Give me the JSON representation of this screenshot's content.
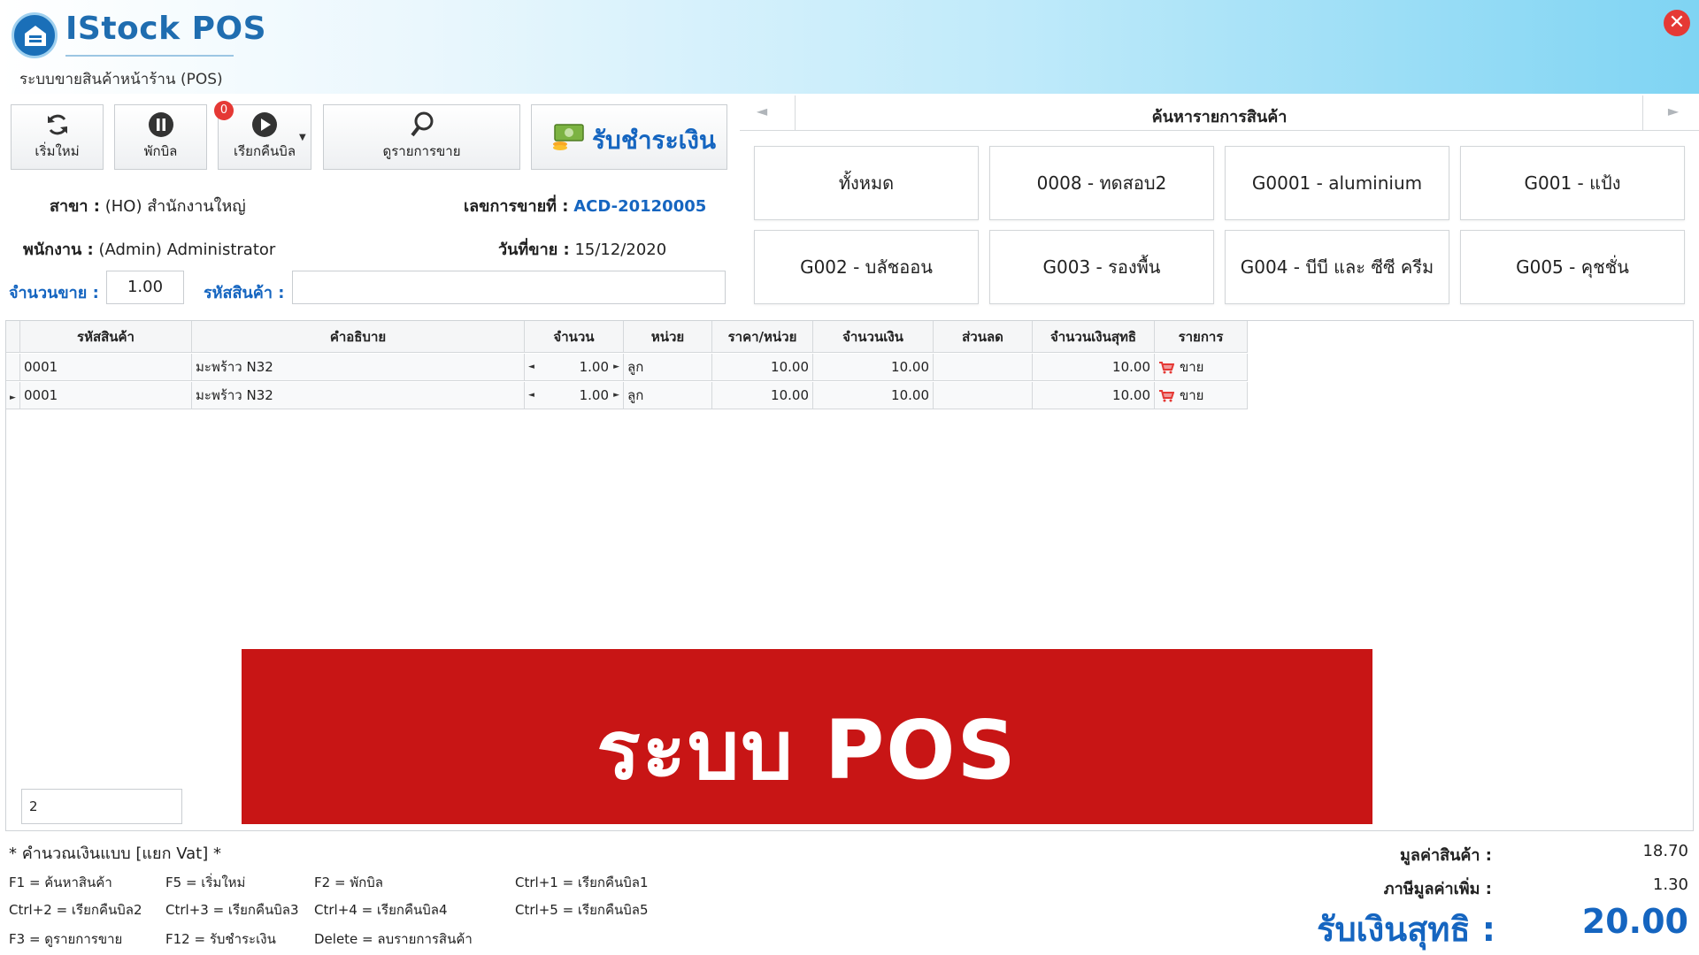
{
  "header": {
    "app_title": "IStock POS",
    "subtitle": "ระบบขายสินค้าหน้าร้าน (POS)",
    "close_symbol": "✕"
  },
  "toolbar": {
    "new_label": "เริ่มใหม่",
    "hold_label": "พักบิล",
    "recall_label": "เรียกคืนบิล",
    "recall_badge": "0",
    "sales_list_label": "ดูรายการขาย",
    "pay_label": "รับชำระเงิน"
  },
  "info": {
    "branch_label": "สาขา :",
    "branch_value": "(HO) สำนักงานใหญ่",
    "invoice_label": "เลขการขายที่ :",
    "invoice_value": "ACD-20120005",
    "staff_label": "พนักงาน :",
    "staff_value": "(Admin) Administrator",
    "date_label": "วันที่ขาย :",
    "date_value": "15/12/2020",
    "qty_label": "จำนวนขาย :",
    "qty_value": "1.00",
    "code_label": "รหัสสินค้า :",
    "code_value": ""
  },
  "product_search": {
    "title": "ค้นหารายการสินค้า",
    "categories": [
      "ทั้งหมด",
      "0008 - ทดสอบ2",
      "G0001 - aluminium",
      "G001 - แป้ง",
      "G002 - บลัชออน",
      "G003 - รองพื้น",
      "G004 - บีบี และ ซีซี ครีม",
      "G005 - คุชชั่น"
    ]
  },
  "grid": {
    "columns": [
      "รหัสสินค้า",
      "คำอธิบาย",
      "จำนวน",
      "หน่วย",
      "ราคา/หน่วย",
      "จำนวนเงิน",
      "ส่วนลด",
      "จำนวนเงินสุทธิ",
      "รายการ"
    ],
    "rows": [
      {
        "code": "0001",
        "desc": "มะพร้าว N32",
        "qty": "1.00",
        "unit": "ลูก",
        "price": "10.00",
        "amount": "10.00",
        "discount": "",
        "net": "10.00",
        "type": "ขาย"
      },
      {
        "code": "0001",
        "desc": "มะพร้าว N32",
        "qty": "1.00",
        "unit": "ลูก",
        "price": "10.00",
        "amount": "10.00",
        "discount": "",
        "net": "10.00",
        "type": "ขาย"
      }
    ],
    "footer_count": "2"
  },
  "banner": {
    "text": "ระบบ POS"
  },
  "bottom": {
    "vat_note": "* คำนวณเงินแบบ [แยก Vat] *",
    "hotkeys": [
      "F1 = ค้นหาสินค้า",
      "F5 = เริ่มใหม่",
      "F2 = พักบิล",
      "Ctrl+1 = เรียกคืนบิล1",
      "Ctrl+2 = เรียกคืนบิล2",
      "Ctrl+3 = เรียกคืนบิล3",
      "Ctrl+4 = เรียกคืนบิล4",
      "Ctrl+5 = เรียกคืนบิล5",
      "F3 = ดูรายการขาย",
      "F12 = รับชำระเงิน",
      "Delete = ลบรายการสินค้า"
    ],
    "subtotal_label": "มูลค่าสินค้า :",
    "subtotal_value": "18.70",
    "vat_label": "ภาษีมูลค่าเพิ่ม :",
    "vat_value": "1.30",
    "net_label": "รับเงินสุทธิ :",
    "net_value": "20.00"
  }
}
